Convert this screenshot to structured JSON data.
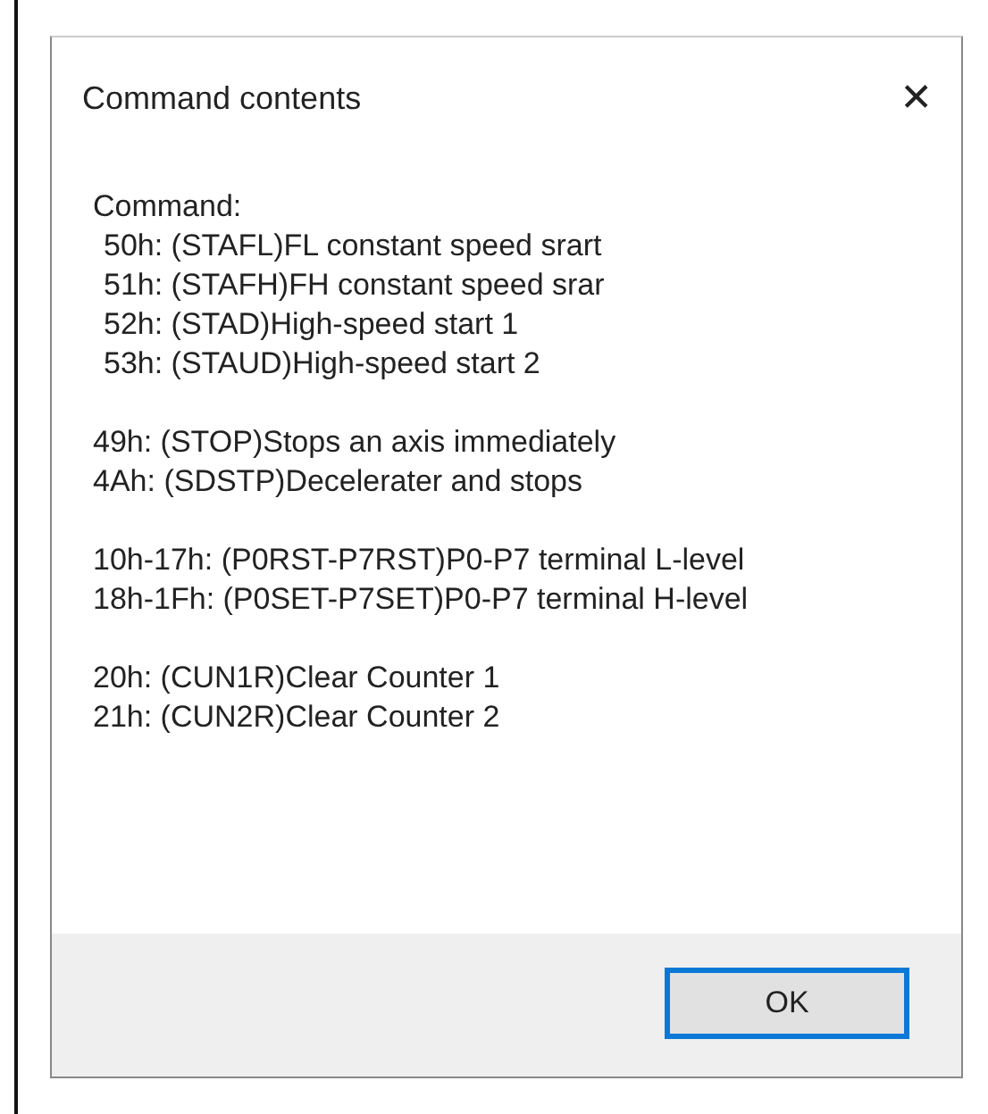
{
  "window": {
    "title": "Command contents",
    "close": "✕"
  },
  "content": {
    "heading": "Command:",
    "groups": [
      {
        "indented": true,
        "lines": [
          "50h: (STAFL)FL constant speed srart",
          "51h: (STAFH)FH constant speed srar",
          "52h: (STAD)High-speed start 1",
          "53h: (STAUD)High-speed start 2"
        ]
      },
      {
        "indented": false,
        "lines": [
          "49h: (STOP)Stops an axis immediately",
          "4Ah: (SDSTP)Decelerater and stops"
        ]
      },
      {
        "indented": false,
        "lines": [
          "10h-17h: (P0RST-P7RST)P0-P7 terminal L-level",
          "18h-1Fh: (P0SET-P7SET)P0-P7 terminal H-level"
        ]
      },
      {
        "indented": false,
        "lines": [
          "20h: (CUN1R)Clear Counter 1",
          "21h: (CUN2R)Clear Counter 2"
        ]
      }
    ]
  },
  "buttons": [
    {
      "label": "OK",
      "default": true
    }
  ]
}
